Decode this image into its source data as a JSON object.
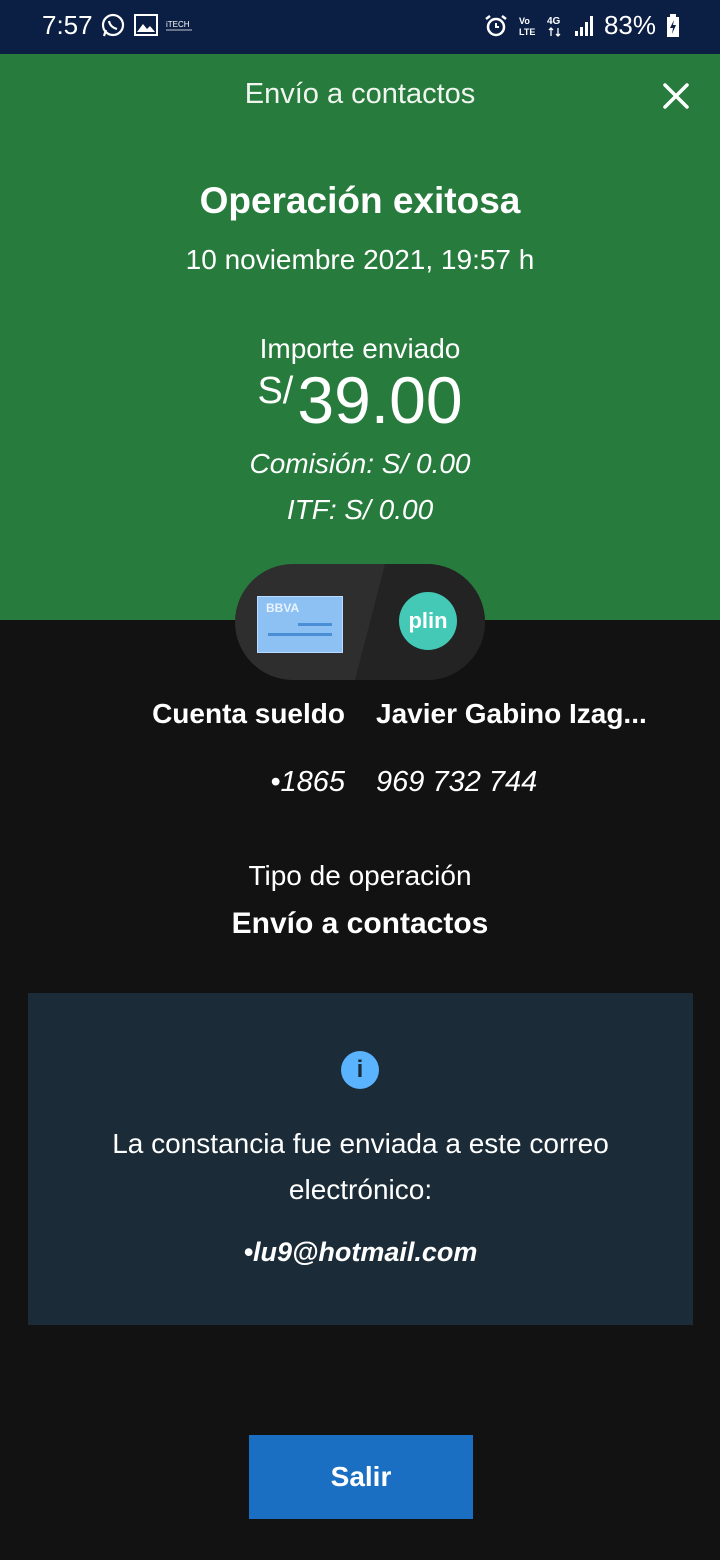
{
  "status_bar": {
    "time": "7:57",
    "left_icons": [
      "whatsapp-icon",
      "image-icon",
      "itech-icon"
    ],
    "right_icons": [
      "alarm-icon",
      "volte-icon",
      "4g-icon",
      "signal-icon"
    ],
    "battery": "83%"
  },
  "header": {
    "title": "Envío a contactos",
    "close_icon": "close-icon"
  },
  "result": {
    "title": "Operación exitosa",
    "datetime": "10 noviembre 2021, 19:57 h",
    "amount_label": "Importe enviado",
    "currency": "S/",
    "amount": "39.00",
    "commission": "Comisión:  S/ 0.00",
    "itf": "ITF:  S/ 0.00"
  },
  "transfer": {
    "from_bank": "BBVA",
    "to_logo": "plin",
    "from_account_name": "Cuenta sueldo",
    "from_account_number": "•1865",
    "to_name": "Javier Gabino Izag...",
    "to_phone": "969 732 744"
  },
  "operation_type": {
    "label": "Tipo de operación",
    "value": "Envío a contactos"
  },
  "info": {
    "icon": "info-icon",
    "message": "La constancia fue enviada a este correo electrónico:",
    "email": "•lu9@hotmail.com"
  },
  "actions": {
    "exit_label": "Salir"
  },
  "colors": {
    "status_bar": "#0b1f44",
    "header_green": "#277c3d",
    "background": "#121212",
    "info_box": "#1b2c38",
    "button_blue": "#1b6fc2"
  }
}
